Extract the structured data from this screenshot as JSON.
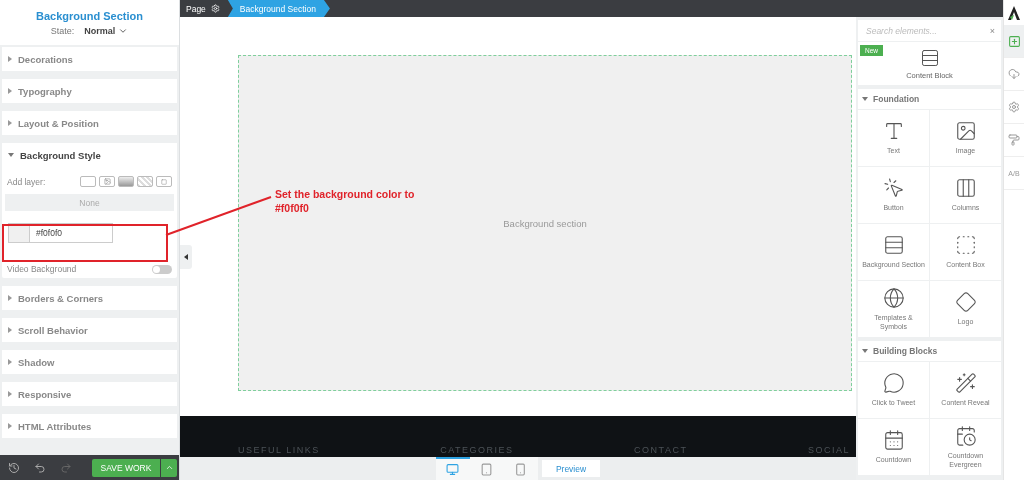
{
  "inspector": {
    "title": "Background Section",
    "state_label": "State:",
    "state_value": "Normal"
  },
  "sections": [
    {
      "title": "Decorations",
      "expanded": false
    },
    {
      "title": "Typography",
      "expanded": false
    },
    {
      "title": "Layout & Position",
      "expanded": false
    },
    {
      "title": "Background Style",
      "expanded": true,
      "body": {
        "add_layer_label": "Add layer:",
        "none_label": "None",
        "color_value": "#f0f0f0",
        "video_label": "Video Background",
        "video_on": false
      }
    },
    {
      "title": "Borders & Corners",
      "expanded": false
    },
    {
      "title": "Scroll Behavior",
      "expanded": false
    },
    {
      "title": "Shadow",
      "expanded": false
    },
    {
      "title": "Responsive",
      "expanded": false
    },
    {
      "title": "HTML Attributes",
      "expanded": false
    }
  ],
  "bottom_bar": {
    "tools": [
      {
        "kind": "history",
        "disabled": false
      },
      {
        "kind": "undo",
        "disabled": false
      },
      {
        "kind": "redo",
        "disabled": true
      }
    ],
    "save_label": "SAVE WORK"
  },
  "breadcrumb": [
    {
      "label": "Page",
      "selected": false
    },
    {
      "label": "Background Section",
      "selected": true
    }
  ],
  "canvas": {
    "section_label": "Background section",
    "footer_headings": [
      "USEFUL LINKS",
      "CATEGORIES",
      "CONTACT",
      "SOCIAL"
    ]
  },
  "devices": [
    {
      "kind": "desktop",
      "selected": true
    },
    {
      "kind": "tablet",
      "selected": false
    },
    {
      "kind": "phone",
      "selected": false
    }
  ],
  "preview_label": "Preview",
  "annotation": {
    "text": "Set the background color to #f0f0f0"
  },
  "elements_panel": {
    "search_placeholder": "Search elements...",
    "close": "×",
    "new_badge": "New",
    "featured": "Content Block",
    "groups": [
      {
        "title": "Foundation",
        "expanded": true,
        "items": [
          {
            "label": "Text",
            "kind": "text"
          },
          {
            "label": "Image",
            "kind": "image"
          },
          {
            "label": "Button",
            "kind": "button"
          },
          {
            "label": "Columns",
            "kind": "columns"
          },
          {
            "label": "Background Section",
            "kind": "section"
          },
          {
            "label": "Content Box",
            "kind": "box"
          },
          {
            "label": "Templates & Symbols",
            "kind": "templates"
          },
          {
            "label": "Logo",
            "kind": "logo"
          }
        ]
      },
      {
        "title": "Building Blocks",
        "expanded": true,
        "items": [
          {
            "label": "Click to Tweet",
            "kind": "tweet"
          },
          {
            "label": "Content Reveal",
            "kind": "reveal"
          },
          {
            "label": "Countdown",
            "kind": "countdown"
          },
          {
            "label": "Countdown Evergreen",
            "kind": "evergreen"
          }
        ]
      }
    ]
  },
  "side_tools": [
    {
      "kind": "add",
      "selected": true
    },
    {
      "kind": "cloud",
      "selected": false
    },
    {
      "kind": "settings",
      "selected": false
    },
    {
      "kind": "style",
      "selected": false
    },
    {
      "kind": "ab",
      "label": "A/B",
      "selected": false
    }
  ]
}
